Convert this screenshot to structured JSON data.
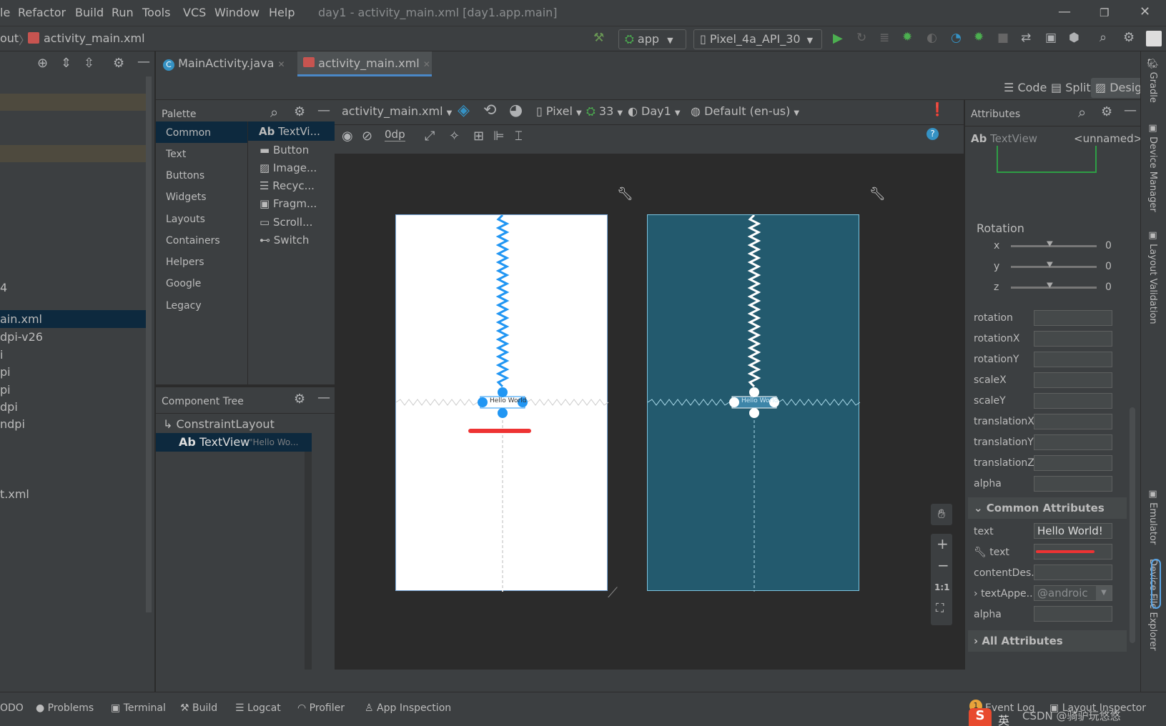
{
  "menubar": {
    "items": [
      "le",
      "Refactor",
      "Build",
      "Run",
      "Tools",
      "VCS",
      "Window",
      "Help"
    ],
    "window_title": "day1 - activity_main.xml [day1.app.main]"
  },
  "navbar": {
    "breadcrumb_prefix": "out",
    "breadcrumb_file": "activity_main.xml",
    "run_config": "app",
    "device": "Pixel_4a_API_30"
  },
  "project": {
    "rows": [
      "4",
      "ain.xml",
      "dpi-v26",
      "i",
      "pi",
      "pi",
      "dpi",
      "ndpi",
      "t.xml"
    ]
  },
  "tabs": [
    "MainActivity.java",
    "activity_main.xml"
  ],
  "modebar": {
    "code": "Code",
    "split": "Split",
    "design": "Design"
  },
  "palette": {
    "title": "Palette",
    "categories": [
      "Common",
      "Text",
      "Buttons",
      "Widgets",
      "Layouts",
      "Containers",
      "Helpers",
      "Google",
      "Legacy"
    ],
    "items": [
      "TextVi...",
      "Button",
      "Image...",
      "Recyc...",
      "Fragm...",
      "Scroll...",
      "Switch"
    ],
    "ab_prefix": "Ab"
  },
  "component_tree": {
    "title": "Component Tree",
    "root": "ConstraintLayout",
    "child": "TextView",
    "child_hint": "\"Hello Wo..."
  },
  "surface_toolbar": {
    "file": "activity_main.xml",
    "device": "Pixel",
    "api": "33",
    "theme": "Day1",
    "locale": "Default (en-us)",
    "margin": "0dp"
  },
  "canvas": {
    "design_label": "Hello World",
    "blueprint_label": "Hello World",
    "zoom_label": "1:1"
  },
  "attributes": {
    "title": "Attributes",
    "widget_type": "TextView",
    "widget_id": "<unnamed>",
    "rotation_section": "Rotation",
    "sliders": [
      {
        "axis": "x",
        "value": "0"
      },
      {
        "axis": "y",
        "value": "0"
      },
      {
        "axis": "z",
        "value": "0"
      }
    ],
    "transform_fields": [
      "rotation",
      "rotationX",
      "rotationY",
      "scaleX",
      "scaleY",
      "translationX",
      "translationY",
      "translationZ",
      "alpha"
    ],
    "common_section": "Common Attributes",
    "text_label": "text",
    "text_value": "Hello World!",
    "tools_text_label": "text",
    "content_desc_label": "contentDes...",
    "text_appearance_label": "textAppe...",
    "text_appearance_value": "@androic",
    "alpha_label": "alpha",
    "all_section": "All Attributes"
  },
  "right_strip": [
    "Gradle",
    "Device Manager",
    "Layout Validation",
    "Emulator",
    "Device File Explorer"
  ],
  "bottom": {
    "items": [
      "ODO",
      "Problems",
      "Terminal",
      "Build",
      "Logcat",
      "Profiler",
      "App Inspection"
    ],
    "right": [
      "Event Log",
      "Layout Inspector"
    ],
    "event_count": "1",
    "watermark": "CSDN @骑驴玩悠悠",
    "ime_label": "英"
  },
  "colors": {
    "blue_accent": "#2196f3",
    "blueprint_bg": "#235a6e",
    "redaction": "#ee3333",
    "run_green": "#4caf50"
  }
}
